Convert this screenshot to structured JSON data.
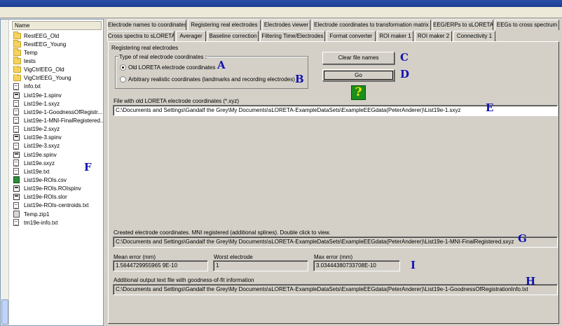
{
  "file_panel": {
    "header": "Name",
    "items": [
      {
        "name": "RestEEG_Old",
        "icon": "folder-icon"
      },
      {
        "name": "RestEEG_Young",
        "icon": "folder-icon"
      },
      {
        "name": "Temp",
        "icon": "folder-icon"
      },
      {
        "name": "tests",
        "icon": "folder-icon"
      },
      {
        "name": "VigCtrlEEG_Old",
        "icon": "folder-icon"
      },
      {
        "name": "VigCtrlEEG_Young",
        "icon": "folder-icon"
      },
      {
        "name": "Info.txt",
        "icon": "text-file-icon"
      },
      {
        "name": "List19e-1.spinv",
        "icon": "spinv-file-icon"
      },
      {
        "name": "List19e-1.sxyz",
        "icon": "text-file-icon"
      },
      {
        "name": "List19e-1-GoodnessOfRegistr...",
        "icon": "text-file-icon"
      },
      {
        "name": "List19e-1-MNI-FinalRegistered...",
        "icon": "text-file-icon"
      },
      {
        "name": "List19e-2.sxyz",
        "icon": "text-file-icon"
      },
      {
        "name": "List19e-3.spinv",
        "icon": "spinv-file-icon"
      },
      {
        "name": "List19e-3.sxyz",
        "icon": "text-file-icon"
      },
      {
        "name": "List19e.spinv",
        "icon": "spinv-file-icon"
      },
      {
        "name": "List19e.sxyz",
        "icon": "text-file-icon"
      },
      {
        "name": "List19e.txt",
        "icon": "text-file-icon"
      },
      {
        "name": "List19e-ROIs.csv",
        "icon": "csv-file-icon"
      },
      {
        "name": "List19e-ROIs.ROIspinv",
        "icon": "spinv-file-icon"
      },
      {
        "name": "List19e-ROIs.slor",
        "icon": "spinv-file-icon"
      },
      {
        "name": "List19e-ROIs-centroids.txt",
        "icon": "text-file-icon"
      },
      {
        "name": "Temp.zip1",
        "icon": "zip-file-icon"
      },
      {
        "name": "tm19e-info.txt",
        "icon": "text-file-icon"
      }
    ],
    "annotation": "F"
  },
  "tabs_row1": [
    "Electrode names to coordinates",
    "Registering real electrodes",
    "Electrodes viewer",
    "Electrode coordinates to transformation matrix",
    "EEG/ERPs to sLORETA",
    "EEGs to cross spectrum"
  ],
  "tabs_row2": [
    "Cross spectra to sLORETA",
    "Averager",
    "Baseline correction",
    "Filtering Time/Electrodes",
    "Format converter",
    "ROI maker 1",
    "ROI maker 2",
    "Connectivity 1"
  ],
  "active_tab": "Registering real electrodes",
  "page": {
    "section_title": "Registering real electrodes",
    "group_title": "Type of real electrode coordinates :",
    "radio_old": "Old LORETA electrode coordinates",
    "radio_arbitrary": "Arbitrary realistic coordinates (landmarks and recording electrodes)",
    "clear_button": "Clear file names",
    "go_button": "Go",
    "help_glyph": "?",
    "input_label": "File with old LORETA electrode coordinates (*.xyz)",
    "input_value": "C:\\Documents and Settings\\Gandalf the Grey\\My Documents\\sLORETA-ExampleDataSets\\ExampleEEGdata(PeterAnderer)\\List19e-1.sxyz",
    "created_label": "Created electrode coordinates. MNI registered (additional splines). Double click to view.",
    "created_value": "C:\\Documents and Settings\\Gandalf the Grey\\My Documents\\sLORETA-ExampleDataSets\\ExampleEEGdata(PeterAnderer)\\List19e-1-MNI-FinalRegistered.sxyz",
    "mean_error_label": "Mean error (mm)",
    "mean_error_value": "1.5644729955965 9E-10",
    "worst_label": "Worst electrode",
    "worst_value": "1",
    "max_error_label": "Max error (mm)",
    "max_error_value": "3.03444380733708E-10",
    "additional_label": "Additional output text file with goodness-of-fit information",
    "additional_value": "C:\\Documents and Settings\\Gandalf the Grey\\My Documents\\sLORETA-ExampleDataSets\\ExampleEEGdata(PeterAnderer)\\List19e-1-GoodnessOfRegistrationInfo.txt"
  },
  "annotations": {
    "A": "A",
    "B": "B",
    "C": "C",
    "D": "D",
    "E": "E",
    "G": "G",
    "H": "H",
    "I": "I"
  }
}
